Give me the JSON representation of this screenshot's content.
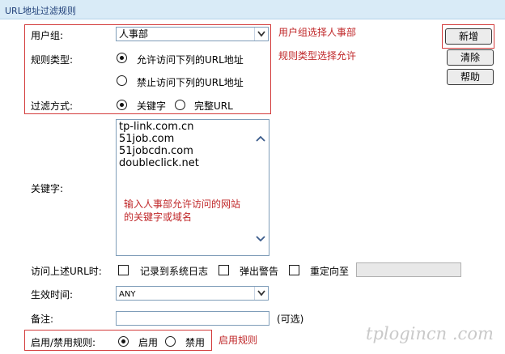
{
  "header": {
    "title": "URL地址过滤规则"
  },
  "form": {
    "user_group": {
      "label": "用户组:",
      "value": "人事部"
    },
    "rule_type": {
      "label": "规则类型:",
      "allow_label": "允许访问下列的URL地址",
      "deny_label": "禁止访问下列的URL地址",
      "selected": "allow"
    },
    "filter_mode": {
      "label": "过滤方式:",
      "keyword_label": "关键字",
      "full_url_label": "完整URL",
      "selected": "keyword"
    },
    "keywords": {
      "label": "关键字:",
      "lines": [
        "tp-link.com.cn",
        "51job.com",
        "51jobcdn.com",
        "doubleclick.net"
      ]
    },
    "url_action": {
      "label": "访问上述URL时:",
      "log_label": "记录到系统日志",
      "alert_label": "弹出警告",
      "redirect_label": "重定向至",
      "redirect_value": ""
    },
    "effective_time": {
      "label": "生效时间:",
      "value": "ANY"
    },
    "note": {
      "label": "备注:",
      "value": "",
      "optional_hint": "(可选)"
    },
    "enable_rule": {
      "label": "启用/禁用规则:",
      "enable_label": "启用",
      "disable_label": "禁用",
      "selected": "enable"
    }
  },
  "buttons": {
    "add": "新增",
    "clear": "清除",
    "help": "帮助"
  },
  "annotations": {
    "user_group": "用户组选择人事部",
    "rule_type": "规则类型选择允许",
    "keywords_line1": "输入人事部允许访问的网站",
    "keywords_line2": "的关键字或域名",
    "enable": "启用规则"
  },
  "watermark": "tplogincn .com",
  "colors": {
    "annotation": "#c0282a",
    "header_bg": "#d9ebf7",
    "header_text": "#1f3f78"
  }
}
